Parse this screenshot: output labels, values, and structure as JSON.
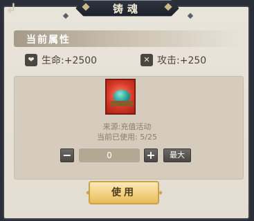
{
  "window": {
    "title": "铸魂",
    "close_label": "↲"
  },
  "section": {
    "title": "当前属性"
  },
  "stats": [
    {
      "icon": "heart-shield-icon",
      "label": "生命:+2500"
    },
    {
      "icon": "crossed-swords-icon",
      "label": "攻击:+250"
    }
  ],
  "item": {
    "icon": "jade-soul-item-icon",
    "source": "来源:充值活动",
    "used": "当前已使用: 5/25"
  },
  "quantity": {
    "minus": "−",
    "value": "0",
    "plus": "+",
    "max": "最大"
  },
  "actions": {
    "use": "使用"
  },
  "colors": {
    "panel": "#e6e0d6",
    "accent": "#f2cf7c",
    "title_bar": "#2a2e38"
  }
}
